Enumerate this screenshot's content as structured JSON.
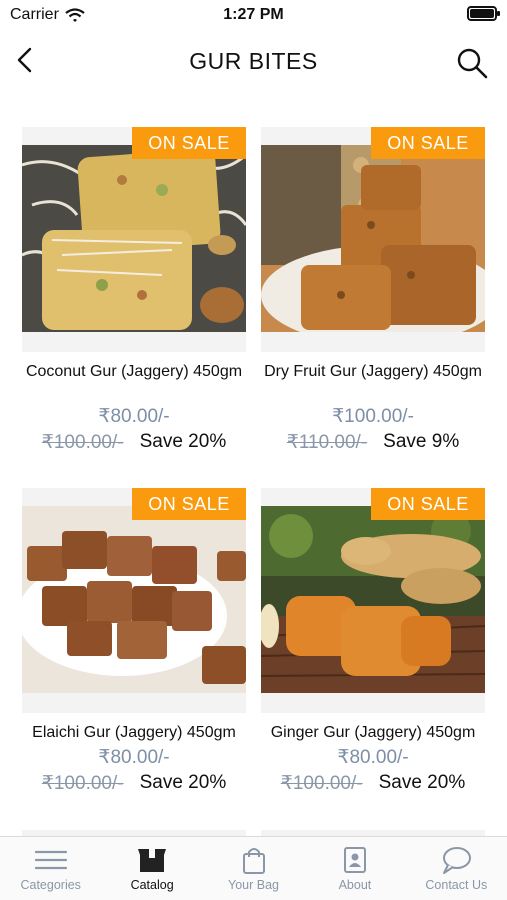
{
  "status_bar": {
    "carrier": "Carrier",
    "time": "1:27 PM"
  },
  "navbar": {
    "title": "GUR BITES"
  },
  "products": [
    {
      "badge": "ON SALE",
      "name": "Coconut Gur (Jaggery) 450gm",
      "price": "₹80.00/-",
      "old_price": "₹100.00/-",
      "save": "Save 20%"
    },
    {
      "badge": "ON SALE",
      "name": "Dry Fruit Gur (Jaggery) 450gm",
      "price": "₹100.00/-",
      "old_price": "₹110.00/-",
      "save": "Save 9%"
    },
    {
      "badge": "ON SALE",
      "name": "Elaichi Gur (Jaggery) 450gm",
      "price": "₹80.00/-",
      "old_price": "₹100.00/-",
      "save": "Save 20%"
    },
    {
      "badge": "ON SALE",
      "name": "Ginger Gur (Jaggery) 450gm",
      "price": "₹80.00/-",
      "old_price": "₹100.00/-",
      "save": "Save 20%"
    }
  ],
  "tabbar": {
    "items": [
      {
        "label": "Categories",
        "icon": "menu-icon"
      },
      {
        "label": "Catalog",
        "icon": "box-icon"
      },
      {
        "label": "Your Bag",
        "icon": "bag-icon"
      },
      {
        "label": "About",
        "icon": "id-card-icon"
      },
      {
        "label": "Contact Us",
        "icon": "chat-bubble-icon"
      }
    ],
    "active": "Catalog"
  },
  "colors": {
    "badge": "#f99a0f",
    "price": "#7d8fa6",
    "muted": "#8a97a8"
  }
}
